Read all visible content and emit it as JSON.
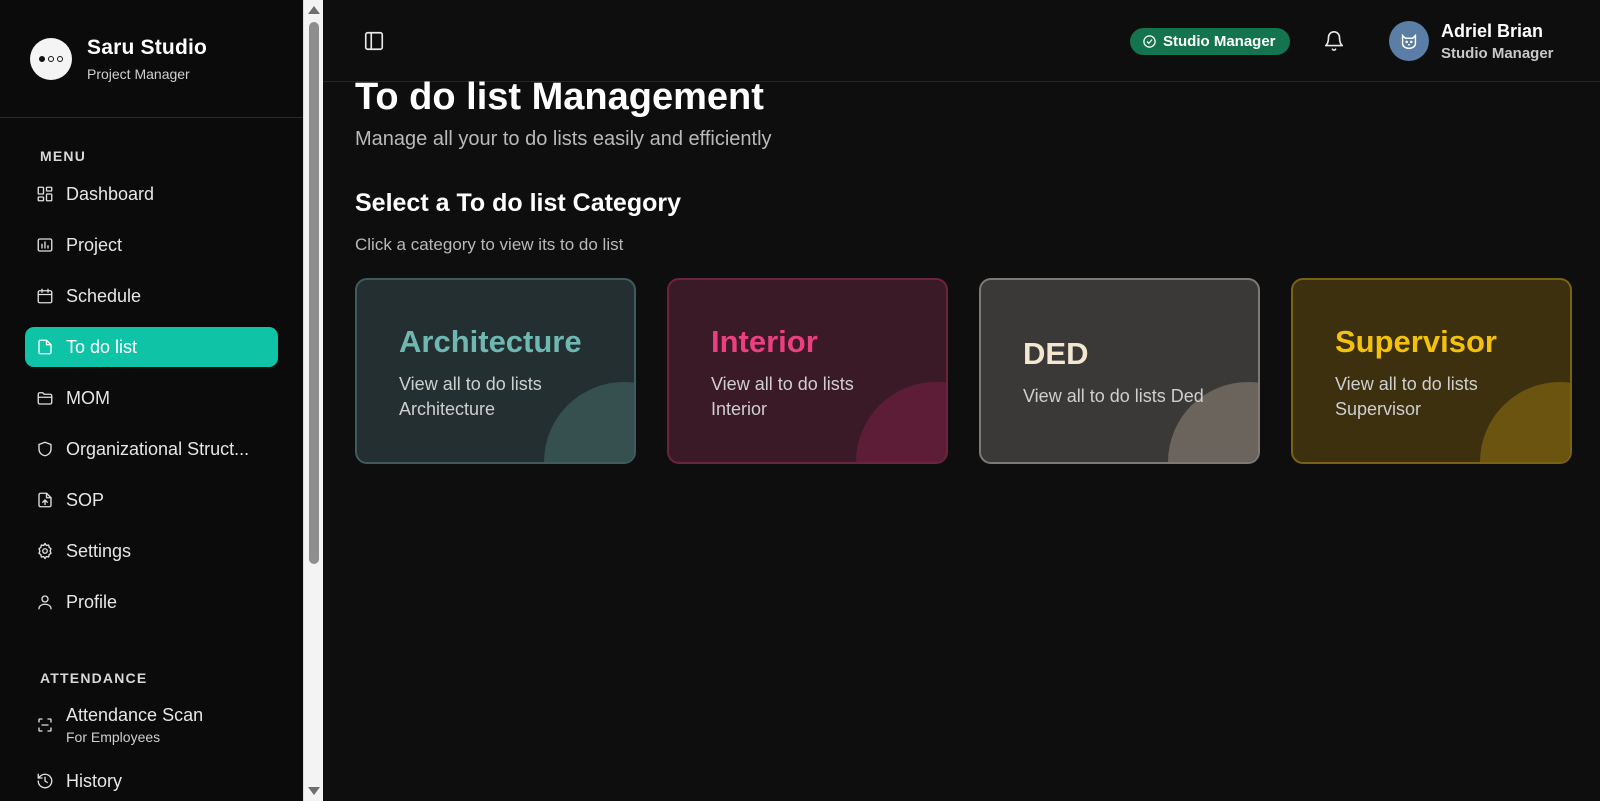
{
  "brand": {
    "name": "Saru Studio",
    "subtitle": "Project Manager"
  },
  "sidebar": {
    "menu_title": "MENU",
    "items": [
      {
        "label": "Dashboard",
        "icon": "dashboard-icon"
      },
      {
        "label": "Project",
        "icon": "project-icon"
      },
      {
        "label": "Schedule",
        "icon": "calendar-icon"
      },
      {
        "label": "To do list",
        "icon": "file-icon",
        "active": true
      },
      {
        "label": "MOM",
        "icon": "folder-icon"
      },
      {
        "label": "Organizational Struct...",
        "icon": "shield-icon"
      },
      {
        "label": "SOP",
        "icon": "file-upload-icon"
      },
      {
        "label": "Settings",
        "icon": "gear-icon"
      },
      {
        "label": "Profile",
        "icon": "user-icon"
      }
    ],
    "attendance_title": "ATTENDANCE",
    "attendance_items": [
      {
        "label": "Attendance Scan",
        "sublabel": "For Employees",
        "icon": "scan-icon"
      },
      {
        "label": "History",
        "icon": "history-icon"
      }
    ]
  },
  "header": {
    "role_badge": "Studio Manager",
    "user": {
      "name": "Adriel Brian",
      "role": "Studio Manager"
    }
  },
  "main": {
    "title": "To do list Management",
    "subtitle": "Manage all your to do lists easily and efficiently",
    "section_title": "Select a To do list Category",
    "section_subtitle": "Click a category to view its to do list",
    "categories": [
      {
        "title": "Architecture",
        "description": "View all to do lists Architecture",
        "accent": "#6fb8b1"
      },
      {
        "title": "Interior",
        "description": "View all to do lists Interior",
        "accent": "#ec3f80"
      },
      {
        "title": "DED",
        "description": "View all to do lists Ded",
        "accent": "#f3e7d2"
      },
      {
        "title": "Supervisor",
        "description": "View all to do lists Supervisor",
        "accent": "#f4c10b"
      }
    ]
  },
  "colors": {
    "accent": "#0fc3a6",
    "badge": "#13744f",
    "background": "#0e0e0e"
  }
}
